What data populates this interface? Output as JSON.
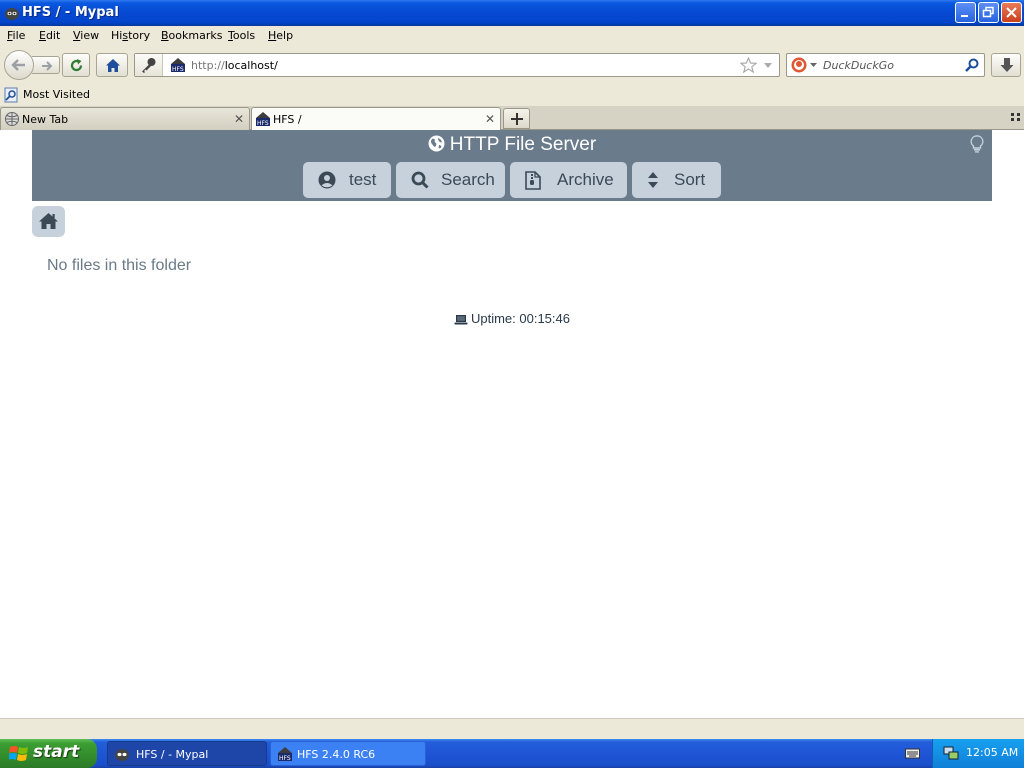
{
  "window": {
    "title": "HFS / - Mypal"
  },
  "menu": {
    "items": [
      {
        "label": "File",
        "mnemonic": "F"
      },
      {
        "label": "Edit",
        "mnemonic": "E"
      },
      {
        "label": "View",
        "mnemonic": "V"
      },
      {
        "label": "History",
        "mnemonic": "s"
      },
      {
        "label": "Bookmarks",
        "mnemonic": "B"
      },
      {
        "label": "Tools",
        "mnemonic": "T"
      },
      {
        "label": "Help",
        "mnemonic": "H"
      }
    ]
  },
  "navbar": {
    "url_protocol": "http://",
    "url_host": "localhost/",
    "search_placeholder": "DuckDuckGo"
  },
  "bookmarks": {
    "most_visited": "Most Visited"
  },
  "tabs": [
    {
      "label": "New Tab",
      "active": false
    },
    {
      "label": "HFS /",
      "active": true
    }
  ],
  "page": {
    "title": "HTTP File Server",
    "buttons": {
      "user": "test",
      "search": "Search",
      "archive": "Archive",
      "sort": "Sort"
    },
    "empty_message": "No files in this folder",
    "uptime": "Uptime: 00:15:46"
  },
  "taskbar": {
    "start": "start",
    "tasks": [
      {
        "label": "HFS / - Mypal",
        "active": true
      },
      {
        "label": "HFS 2.4.0 RC6",
        "active": false
      }
    ],
    "clock": "12:05 AM"
  },
  "colors": {
    "hfs_header": "#6a7b8b",
    "hfs_button": "#c7d1dc",
    "xp_titlebar": "#0649d2",
    "xp_taskbar": "#245edb",
    "xp_start": "#3c9e33"
  }
}
